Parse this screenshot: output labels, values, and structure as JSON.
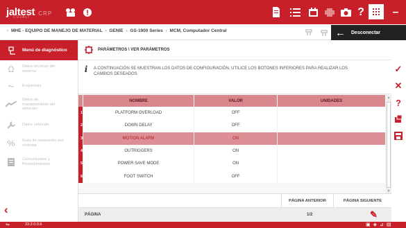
{
  "app": {
    "logo": "jaltest",
    "logo_sub": "COJALI",
    "logo_product": "CRP"
  },
  "top_icons": [
    "car-icon",
    "alert-icon",
    "document-icon",
    "list-icon",
    "calendar-icon",
    "print-icon",
    "camera-icon",
    "help-icon",
    "apps-icon"
  ],
  "window_controls": {
    "minimize": "–",
    "maximize": "□",
    "close": "✕"
  },
  "breadcrumb": [
    "MHE - EQUIPO DE MANEJO DE MATERIAL",
    "GENIE",
    "GS-1900 Series",
    "MCM, Computador Central"
  ],
  "disconnect_label": "Desconectar",
  "sidebar": {
    "header": "Menú de diagnóstico",
    "items": [
      {
        "label": "Datos técnicos del sistema",
        "icon": "omega-icon"
      },
      {
        "label": "Esquemas",
        "icon": "schematic-icon"
      },
      {
        "label": "Datos de mantenimiento del vehículo",
        "icon": "maintenance-icon"
      },
      {
        "label": "Datos vehículo",
        "icon": "wrench-icon"
      },
      {
        "label": "Guía de reparación por síntoma",
        "icon": "percent-icon"
      },
      {
        "label": "Comunicados y Procedimientos",
        "icon": "document-icon"
      }
    ]
  },
  "main": {
    "title": "PARÁMETROS \\ VER PARÁMETROS",
    "info": "A CONTINUACIÓN SE MUESTRAN LOS DATOS DE CONFIGURACIÓN. UTILICE LOS BOTONES INFERIORES PARA REALIZAR LOS CAMBIOS DESEADOS",
    "columns": [
      "NOMBRE",
      "VALOR",
      "UNIDADES"
    ],
    "rows": [
      {
        "num": "1",
        "name": "PLATFORM OVERLOAD",
        "value": "OFF",
        "units": ""
      },
      {
        "num": "2",
        "name": "DOWN DELAY",
        "value": "OFF",
        "units": ""
      },
      {
        "num": "3",
        "name": "MOTION ALARM",
        "value": "ON",
        "units": "",
        "selected": true
      },
      {
        "num": "4",
        "name": "OUTRIGGERS",
        "value": "ON",
        "units": ""
      },
      {
        "num": "5",
        "name": "POWER SAVE MODE",
        "value": "ON",
        "units": ""
      },
      {
        "num": "6",
        "name": "FOOT SWITCH",
        "value": "OFF",
        "units": ""
      }
    ],
    "prev_page": "PÁGINA ANTERIOR",
    "next_page": "PÁGINA SIGUIENTE",
    "page_label": "PÁGINA",
    "page_value": "1/2"
  },
  "status": {
    "version": "23.2.0.0.6"
  },
  "colors": {
    "brand": "#c8202a",
    "header_row": "#d9868d",
    "selected_row": "#dd8f95"
  }
}
